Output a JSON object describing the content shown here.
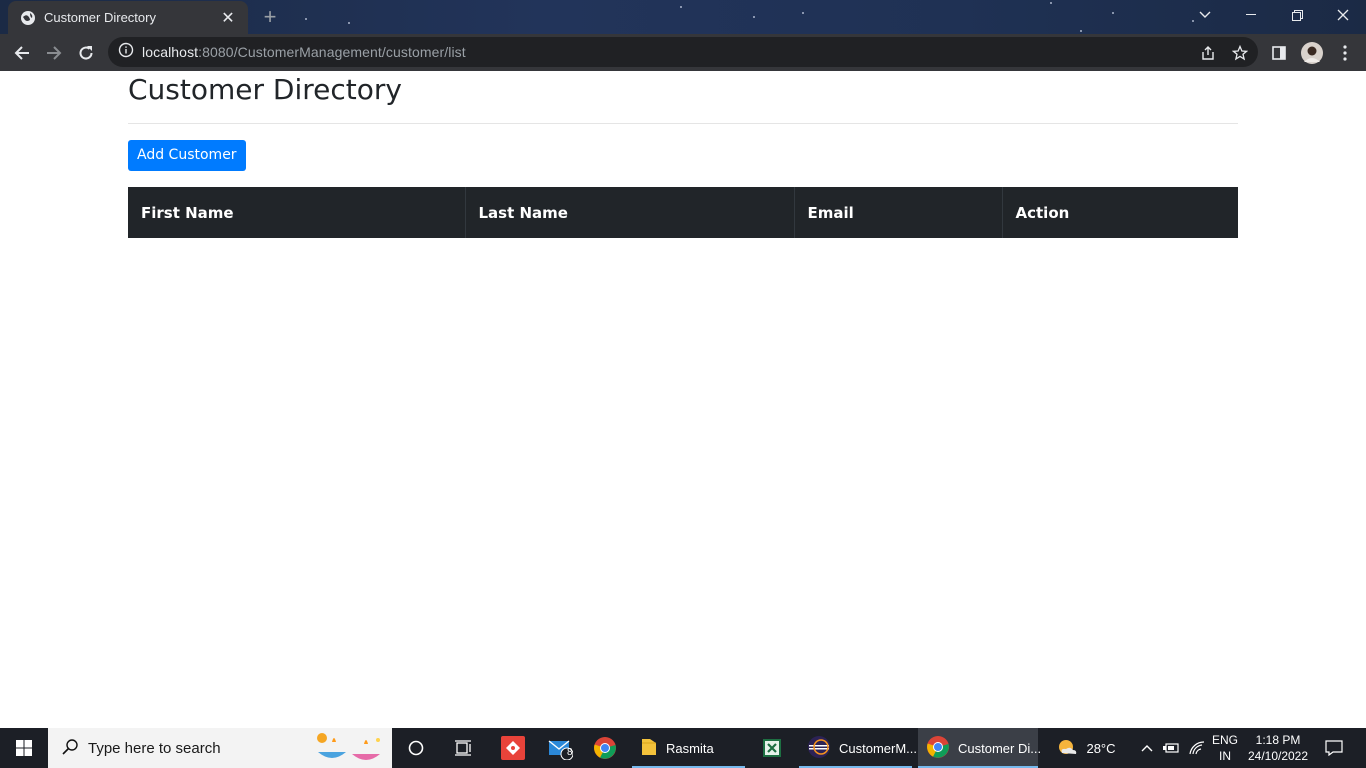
{
  "browser": {
    "tab_title": "Customer Directory",
    "url_host": "localhost",
    "url_rest": ":8080/CustomerManagement/customer/list"
  },
  "page": {
    "title": "Customer Directory",
    "add_button_label": "Add Customer",
    "table": {
      "columns": [
        "First Name",
        "Last Name",
        "Email",
        "Action"
      ],
      "rows": []
    }
  },
  "taskbar": {
    "search_placeholder": "Type here to search",
    "mail_badge": "8",
    "apps": [
      {
        "label": "Rasmita",
        "icon": "folder-icon"
      },
      {
        "label": "CustomerM...",
        "icon": "eclipse-icon"
      },
      {
        "label": "Customer Di...",
        "icon": "chrome-icon"
      }
    ],
    "weather": "28°C",
    "language": "ENG",
    "region": "IN",
    "time": "1:18 PM",
    "date": "24/10/2022"
  },
  "colors": {
    "primary_button": "#007bff",
    "table_header": "#212529",
    "taskbar_bg": "#1c1f26",
    "chrome_toolbar": "#35363a"
  }
}
